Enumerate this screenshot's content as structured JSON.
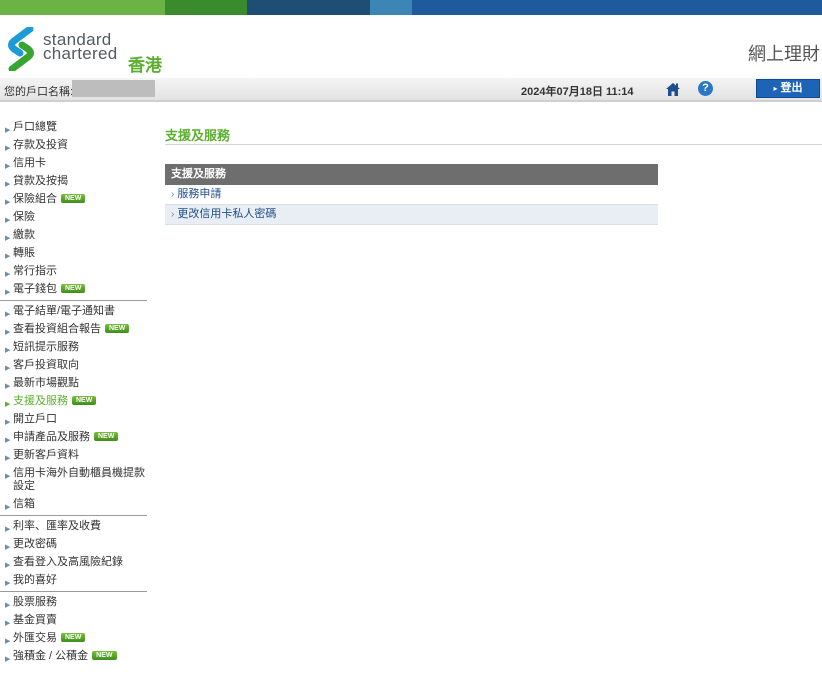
{
  "brand": {
    "line1": "standard",
    "line2": "chartered",
    "region": "香港",
    "colors": {
      "green": "#5cb02f",
      "blue": "#1d64b6",
      "strip": [
        "#6ab344",
        "#3a8a2e",
        "#1f4e74",
        "#3b86b5",
        "#1e5a9c"
      ]
    }
  },
  "app_title": "網上理財",
  "account_bar": {
    "label": "您的戶口名稱:",
    "datetime": "2024年07月18日 11:14",
    "logout_label": "登出",
    "icons": {
      "home": "home-icon",
      "help": "help-icon"
    },
    "help_glyph": "?"
  },
  "badge_text": "NEW",
  "sidebar": {
    "groups": [
      [
        {
          "label": "戶口總覽",
          "new": false
        },
        {
          "label": "存款及投資",
          "new": false
        },
        {
          "label": "信用卡",
          "new": false
        },
        {
          "label": "貸款及按揭",
          "new": false
        },
        {
          "label": "保險組合",
          "new": true
        },
        {
          "label": "保險",
          "new": false
        },
        {
          "label": "繳款",
          "new": false
        },
        {
          "label": "轉賬",
          "new": false
        },
        {
          "label": "常行指示",
          "new": false
        },
        {
          "label": "電子錢包",
          "new": true
        }
      ],
      [
        {
          "label": "電子結單/電子通知書",
          "new": false
        },
        {
          "label": "查看投資組合報告",
          "new": true
        },
        {
          "label": "短訊提示服務",
          "new": false
        },
        {
          "label": "客戶投資取向",
          "new": false
        },
        {
          "label": "最新市場觀點",
          "new": false
        },
        {
          "label": "支援及服務",
          "new": true,
          "active": true
        },
        {
          "label": "開立戶口",
          "new": false
        },
        {
          "label": "申請產品及服務",
          "new": true
        },
        {
          "label": "更新客戶資料",
          "new": false
        },
        {
          "label": "信用卡海外自動櫃員機提款設定",
          "new": false
        },
        {
          "label": "信箱",
          "new": false
        }
      ],
      [
        {
          "label": "利率、匯率及收費",
          "new": false
        },
        {
          "label": "更改密碼",
          "new": false
        },
        {
          "label": "查看登入及高風險紀錄",
          "new": false
        },
        {
          "label": "我的喜好",
          "new": false
        }
      ],
      [
        {
          "label": "股票服務",
          "new": false
        },
        {
          "label": "基金買賣",
          "new": false
        },
        {
          "label": "外匯交易",
          "new": true
        },
        {
          "label": "強積金 / 公積金",
          "new": true
        }
      ]
    ]
  },
  "main": {
    "title": "支援及服務",
    "panel": {
      "header": "支援及服務",
      "links": [
        "服務申請",
        "更改信用卡私人密碼"
      ]
    }
  }
}
